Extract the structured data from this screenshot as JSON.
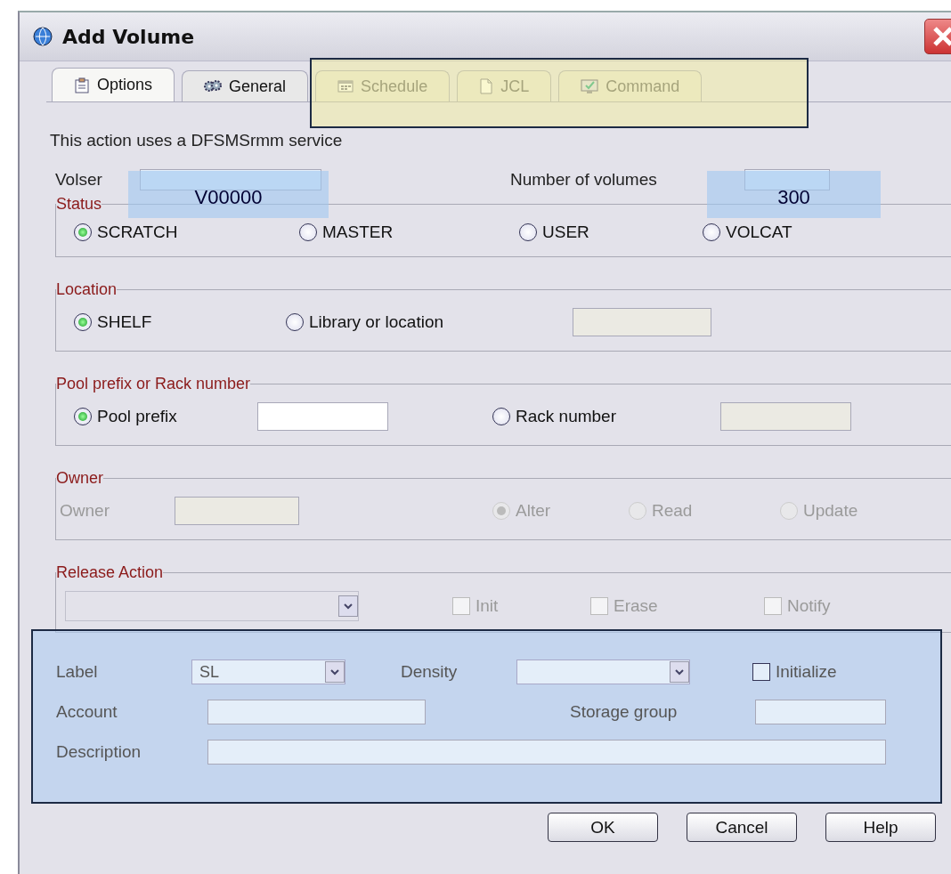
{
  "window": {
    "title": "Add Volume"
  },
  "tabs": [
    {
      "label": "Options",
      "selected": true
    },
    {
      "label": "General",
      "selected": false
    },
    {
      "label": "Schedule",
      "selected": false
    },
    {
      "label": "JCL",
      "selected": false
    },
    {
      "label": "Command",
      "selected": false
    }
  ],
  "notice": "This action uses a DFSMSrmm service",
  "volser": {
    "label": "Volser",
    "annotation": "V00000"
  },
  "number_of_volumes": {
    "label": "Number of volumes",
    "annotation": "300"
  },
  "status": {
    "title": "Status",
    "options": [
      {
        "label": "SCRATCH",
        "selected": true
      },
      {
        "label": "MASTER",
        "selected": false
      },
      {
        "label": "USER",
        "selected": false
      },
      {
        "label": "VOLCAT",
        "selected": false
      }
    ]
  },
  "location": {
    "title": "Location",
    "options": [
      {
        "label": "SHELF",
        "selected": true
      },
      {
        "label": "Library or location",
        "selected": false
      }
    ],
    "field": {
      "disabled": true
    }
  },
  "pool": {
    "title": "Pool prefix or Rack number",
    "options": [
      {
        "label": "Pool prefix",
        "selected": true,
        "field_disabled": false
      },
      {
        "label": "Rack number",
        "selected": false,
        "field_disabled": true
      }
    ]
  },
  "owner": {
    "title": "Owner",
    "disabled": true,
    "field_label": "Owner",
    "options": [
      {
        "label": "Alter",
        "selected": true
      },
      {
        "label": "Read",
        "selected": false
      },
      {
        "label": "Update",
        "selected": false
      }
    ]
  },
  "release_action": {
    "title": "Release Action",
    "disabled": true,
    "checkboxes": [
      {
        "label": "Init",
        "checked": false
      },
      {
        "label": "Erase",
        "checked": false
      },
      {
        "label": "Notify",
        "checked": false
      }
    ]
  },
  "details": {
    "label": {
      "label": "Label",
      "value": "SL"
    },
    "density": {
      "label": "Density"
    },
    "initialize": {
      "label": "Initialize",
      "checked": false
    },
    "account": {
      "label": "Account"
    },
    "storage_group": {
      "label": "Storage group"
    },
    "description": {
      "label": "Description"
    }
  },
  "buttons": [
    "OK",
    "Cancel",
    "Help"
  ]
}
